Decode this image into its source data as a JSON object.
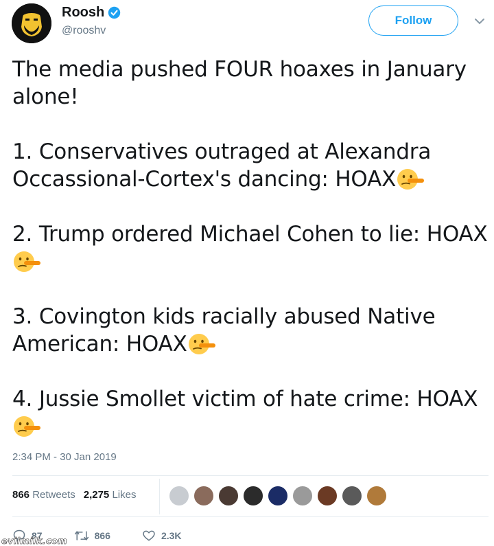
{
  "user": {
    "name": "Roosh",
    "handle": "@rooshv",
    "follow_label": "Follow"
  },
  "tweet": {
    "paragraphs": [
      {
        "text": "The media pushed FOUR hoaxes in January alone!",
        "emoji": false
      },
      {
        "text": "1. Conservatives outraged at Alexandra Occassional-Cortex's dancing: HOAX",
        "emoji": true
      },
      {
        "text": "2. Trump ordered Michael Cohen to lie: HOAX ",
        "emoji": true
      },
      {
        "text": "3. Covington kids racially abused Native American: HOAX",
        "emoji": true
      },
      {
        "text": "4. Jussie Smollet victim of hate crime: HOAX ",
        "emoji": true
      }
    ],
    "emoji_icon": "lying-face-icon",
    "timestamp": "2:34 PM - 30 Jan 2019"
  },
  "stats": {
    "retweets_count": "866",
    "retweets_label": "Retweets",
    "likes_count": "2,275",
    "likes_label": "Likes"
  },
  "likers": [
    {
      "color": "#c8ccd1"
    },
    {
      "color": "#8a6b5c"
    },
    {
      "color": "#4a3a33"
    },
    {
      "color": "#2b2b2b"
    },
    {
      "color": "#1b2c66"
    },
    {
      "color": "#9a9a9a"
    },
    {
      "color": "#6b3a24"
    },
    {
      "color": "#5a5a5a"
    },
    {
      "color": "#b07a3a"
    }
  ],
  "actions": {
    "replies": "87",
    "retweets": "866",
    "likes": "2.3K"
  },
  "watermark": "evilmilk.com",
  "colors": {
    "accent": "#1da1f2",
    "muted": "#657786",
    "text": "#14171a"
  }
}
